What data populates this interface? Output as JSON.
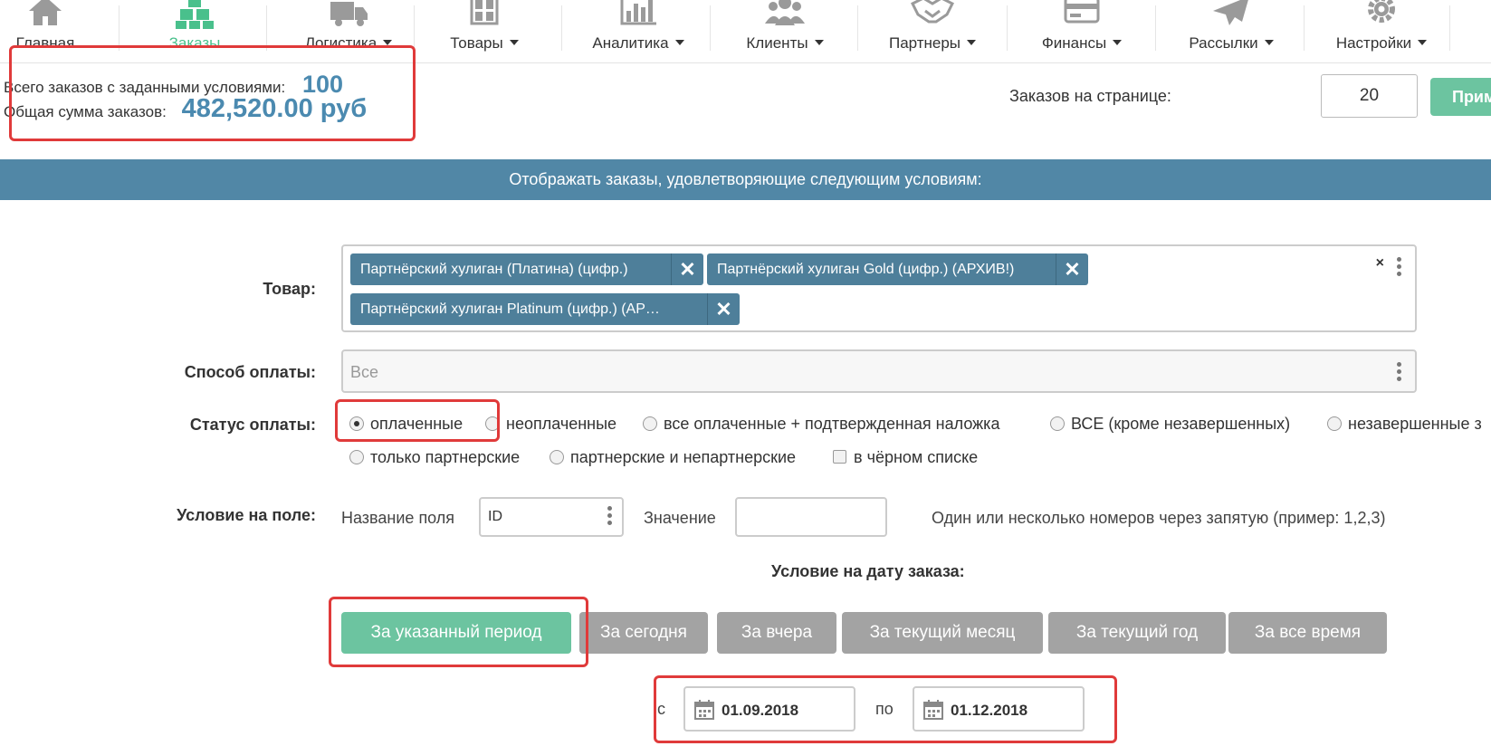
{
  "nav": {
    "items": [
      {
        "label": "Главная",
        "icon": "home-icon",
        "dropdown": false,
        "active": false
      },
      {
        "label": "Заказы",
        "icon": "cubes-icon",
        "dropdown": false,
        "active": true
      },
      {
        "label": "Логистика",
        "icon": "truck-icon",
        "dropdown": true,
        "active": false
      },
      {
        "label": "Товары",
        "icon": "shelf-icon",
        "dropdown": true,
        "active": false
      },
      {
        "label": "Аналитика",
        "icon": "bar-chart-icon",
        "dropdown": true,
        "active": false
      },
      {
        "label": "Клиенты",
        "icon": "users-icon",
        "dropdown": true,
        "active": false
      },
      {
        "label": "Партнеры",
        "icon": "handshake-icon",
        "dropdown": true,
        "active": false
      },
      {
        "label": "Финансы",
        "icon": "credit-card-icon",
        "dropdown": true,
        "active": false
      },
      {
        "label": "Рассылки",
        "icon": "paper-plane-icon",
        "dropdown": true,
        "active": false
      },
      {
        "label": "Настройки",
        "icon": "gear-icon",
        "dropdown": true,
        "active": false
      }
    ],
    "active_color": "#49c08c"
  },
  "summary": {
    "total_orders_label": "Всего заказов с заданными условиями:",
    "total_orders_value": "100",
    "total_sum_label": "Общая сумма заказов:",
    "total_sum_value": "482,520.00 руб"
  },
  "pagination": {
    "per_page_label": "Заказов на странице:",
    "per_page_value": "20",
    "apply_label": "Прим"
  },
  "banner": {
    "text": "Отображать заказы, удовлетворяющие следующим условиям:"
  },
  "filters": {
    "product": {
      "label": "Товар:",
      "tags": [
        "Партнёрский хулиган (Платина) (цифр.)",
        "Партнёрский хулиган Gold (цифр.) (АРХИВ!)",
        "Партнёрский хулиган Platinum (цифр.) (АР…"
      ],
      "clear_symbol": "×",
      "remove_symbol": "✕"
    },
    "payment_method": {
      "label": "Способ оплаты:",
      "placeholder": "Все"
    },
    "payment_status": {
      "label": "Статус оплаты:",
      "options_row1": [
        {
          "label": "оплаченные",
          "checked": true
        },
        {
          "label": "неоплаченные",
          "checked": false
        },
        {
          "label": "все оплаченные + подтвержденная наложка",
          "checked": false
        },
        {
          "label": "ВСЕ (кроме незавершенных)",
          "checked": false
        },
        {
          "label": "незавершенные з",
          "checked": false
        }
      ],
      "options_row2": [
        {
          "label": "только партнерские",
          "checked": false
        },
        {
          "label": "партнерские и непартнерские",
          "checked": false
        }
      ],
      "blacklist_label": "в чёрном списке",
      "blacklist_checked": false
    },
    "field_condition": {
      "label": "Условие на поле:",
      "field_name_label": "Название поля",
      "field_name_value": "ID",
      "value_label": "Значение",
      "value_value": "",
      "hint": "Один или несколько номеров через запятую (пример: 1,2,3)"
    },
    "date_condition": {
      "title": "Условие на дату заказа:",
      "buttons": [
        {
          "label": "За указанный период",
          "active": true
        },
        {
          "label": "За сегодня",
          "active": false
        },
        {
          "label": "За вчера",
          "active": false
        },
        {
          "label": "За текущий месяц",
          "active": false
        },
        {
          "label": "За текущий год",
          "active": false
        },
        {
          "label": "За все время",
          "active": false
        }
      ],
      "from_label": "с",
      "from_value": "01.09.2018",
      "to_label": "по",
      "to_value": "01.12.2018"
    }
  },
  "colors": {
    "accent_green": "#6cc4a0",
    "banner_blue": "#5187a6",
    "tag_blue": "#4e7f9a",
    "highlight_red": "#e03a3a",
    "summary_blue": "#4b8ab0"
  }
}
